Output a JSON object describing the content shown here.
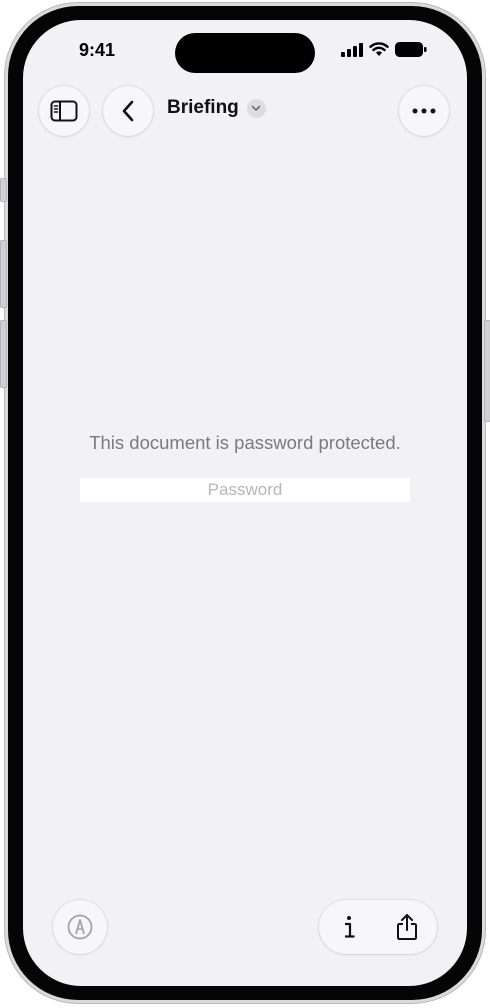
{
  "status_bar": {
    "time": "9:41",
    "icons": [
      "cellular-signal-icon",
      "wifi-icon",
      "battery-icon"
    ]
  },
  "toolbar": {
    "sidebar_icon": "sidebar-icon",
    "back_icon": "chevron-left-icon",
    "title": "Briefing",
    "title_menu_icon": "chevron-down-icon",
    "more_icon": "ellipsis-icon"
  },
  "main": {
    "message": "This document is password protected.",
    "password_placeholder": "Password",
    "password_value": ""
  },
  "bottom_bar": {
    "markup_icon": "markup-pen-icon",
    "info_icon": "info-icon",
    "share_icon": "share-icon"
  },
  "colors": {
    "screen_background": "#f2f1f6",
    "message_text": "#7a7a7f",
    "placeholder_text": "#b6b6bb"
  }
}
